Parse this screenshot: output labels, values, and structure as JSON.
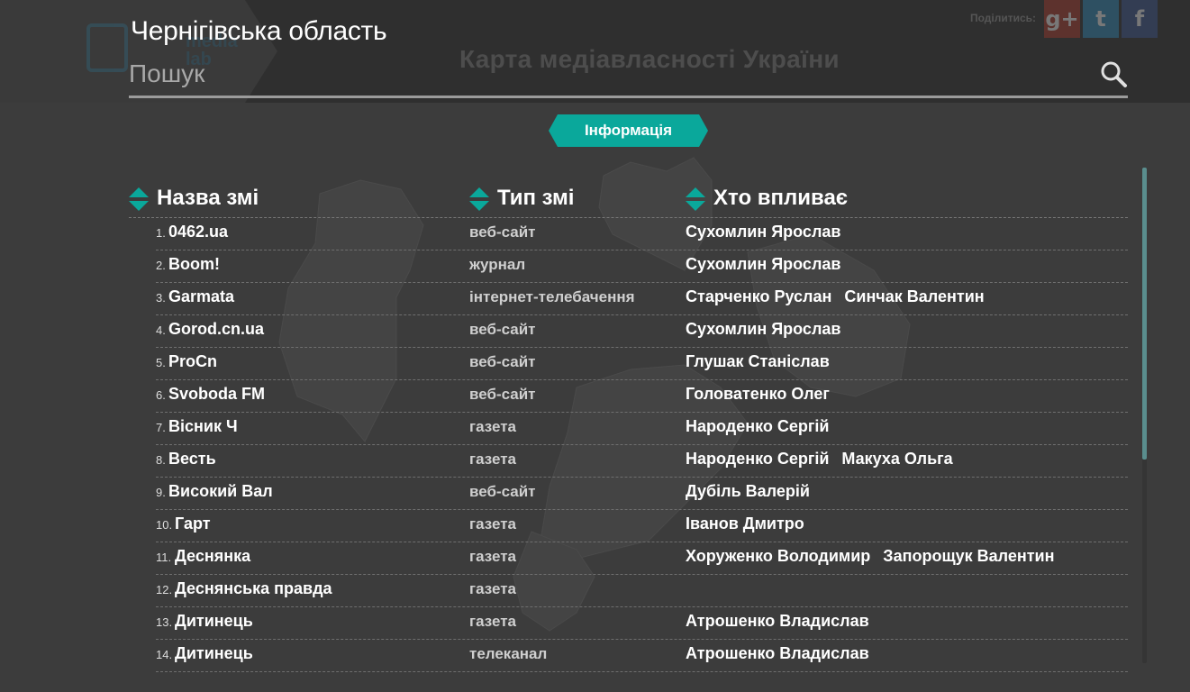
{
  "header": {
    "region_title": "Чернігівська область",
    "site_title": "Карта медіавласності України",
    "logo_text": "media lab",
    "share_label": "Поділитись:",
    "share": [
      "g+",
      "t",
      "f"
    ]
  },
  "search": {
    "placeholder": "Пошук",
    "value": ""
  },
  "info_tab": {
    "label": "Інформація",
    "color": "#0aa89b"
  },
  "table": {
    "headers": {
      "name": "Назва змі",
      "type": "Тип змі",
      "influencers": "Хто впливає"
    },
    "rows": [
      {
        "num": "1.",
        "name": "0462.ua",
        "type": "веб-сайт",
        "influencers": [
          "Сухомлин Ярослав"
        ]
      },
      {
        "num": "2.",
        "name": "Boom!",
        "type": "журнал",
        "influencers": [
          "Сухомлин Ярослав"
        ]
      },
      {
        "num": "3.",
        "name": "Garmata",
        "type": "інтернет-телебачення",
        "influencers": [
          "Старченко Руслан",
          "Синчак Валентин"
        ]
      },
      {
        "num": "4.",
        "name": "Gorod.cn.ua",
        "type": "веб-сайт",
        "influencers": [
          "Сухомлин Ярослав"
        ]
      },
      {
        "num": "5.",
        "name": "ProCn",
        "type": "веб-сайт",
        "influencers": [
          "Глушак Станіслав"
        ]
      },
      {
        "num": "6.",
        "name": "Svoboda FM",
        "type": "веб-сайт",
        "influencers": [
          "Головатенко Олег"
        ]
      },
      {
        "num": "7.",
        "name": "Вісник Ч",
        "type": "газета",
        "influencers": [
          "Народенко Сергій"
        ]
      },
      {
        "num": "8.",
        "name": "Весть",
        "type": "газета",
        "influencers": [
          "Народенко Сергій",
          "Макуха Ольга"
        ]
      },
      {
        "num": "9.",
        "name": "Високий Вал",
        "type": "веб-сайт",
        "influencers": [
          "Дубіль Валерій"
        ]
      },
      {
        "num": "10.",
        "name": "Гарт",
        "type": "газета",
        "influencers": [
          "Іванов Дмитро"
        ]
      },
      {
        "num": "11.",
        "name": "Деснянка",
        "type": "газета",
        "influencers": [
          "Хоруженко Володимир",
          "Запорощук Валентин"
        ]
      },
      {
        "num": "12.",
        "name": "Деснянська правда",
        "type": "газета",
        "influencers": []
      },
      {
        "num": "13.",
        "name": "Дитинець",
        "type": "газета",
        "influencers": [
          "Атрошенко Владислав"
        ]
      },
      {
        "num": "14.",
        "name": "Дитинець",
        "type": "телеканал",
        "influencers": [
          "Атрошенко Владислав"
        ]
      }
    ]
  },
  "colors": {
    "accent": "#0aa89b",
    "background": "#3c3c3c",
    "header_dark": "#2f2f2f",
    "scroll_thumb": "#5a8e8e"
  }
}
